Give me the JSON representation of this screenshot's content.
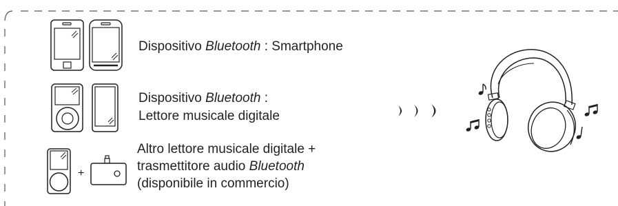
{
  "rows": [
    {
      "line1_prefix": "Dispositivo ",
      "line1_italic": "Bluetooth",
      "line1_suffix": " : Smartphone"
    },
    {
      "line1_prefix": "Dispositivo ",
      "line1_italic": "Bluetooth",
      "line1_suffix": " :",
      "line2": "Lettore musicale digitale"
    },
    {
      "line1": "Altro lettore musicale digitale +",
      "line2_prefix": "trasmettitore audio ",
      "line2_italic": "Bluetooth",
      "line3": "(disponibile in commercio)",
      "plus": "+"
    }
  ],
  "icons": {
    "phone_1": "smartphone-icon",
    "phone_2": "smartphone-icon",
    "player_1": "music-player-icon",
    "player_2": "music-player-icon",
    "player_3": "music-player-icon",
    "transmitter": "audio-transmitter-icon",
    "arrows": "signal-arrows-icon",
    "headphones": "headphones-icon",
    "notes": "music-note-icon"
  }
}
